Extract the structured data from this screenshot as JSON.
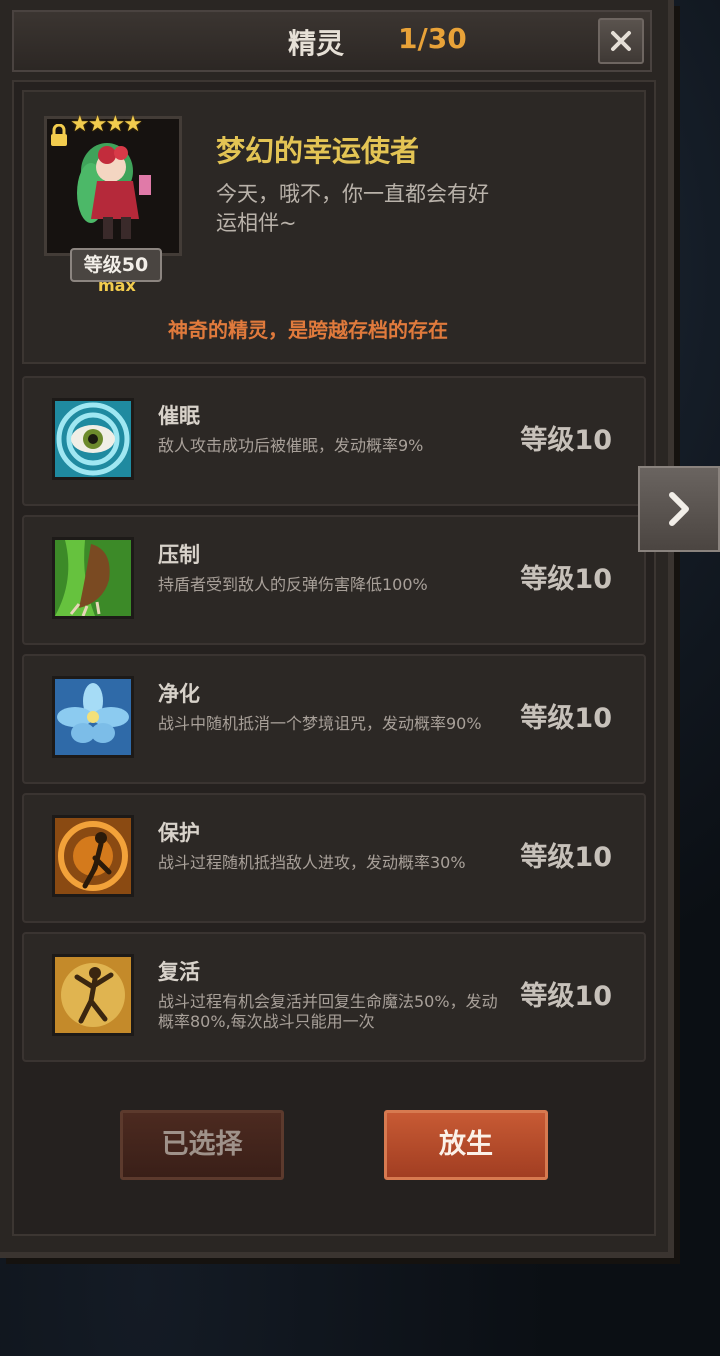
{
  "header": {
    "title": "精灵",
    "count": "1/30"
  },
  "pet": {
    "name": "梦幻的幸运使者",
    "description": "今天，哦不，你一直都会有好运相伴~",
    "level": "等级50",
    "level_max": "max",
    "stars": 4,
    "note": "神奇的精灵，是跨越存档的存在"
  },
  "skills": [
    {
      "name": "催眠",
      "desc": "敌人攻击成功后被催眠，发动概率9%",
      "level": "等级10",
      "icon": "eye-icon"
    },
    {
      "name": "压制",
      "desc": "持盾者受到敌人的反弹伤害降低100%",
      "level": "等级10",
      "icon": "claw-icon"
    },
    {
      "name": "净化",
      "desc": "战斗中随机抵消一个梦境诅咒，发动概率90%",
      "level": "等级10",
      "icon": "flower-icon"
    },
    {
      "name": "保护",
      "desc": "战斗过程随机抵挡敌人进攻，发动概率30%",
      "level": "等级10",
      "icon": "fairy-shield-icon"
    },
    {
      "name": "复活",
      "desc": "战斗过程有机会复活并回复生命魔法50%，发动概率80%,每次战斗只能用一次",
      "level": "等级10",
      "icon": "dancing-figure-icon"
    }
  ],
  "buttons": {
    "selected": "已选择",
    "release": "放生"
  },
  "colors": {
    "accent_gold": "#e3c454",
    "count_orange": "#e8a238",
    "note_orange": "#e07a3c",
    "release_button": "#b84a2a"
  }
}
